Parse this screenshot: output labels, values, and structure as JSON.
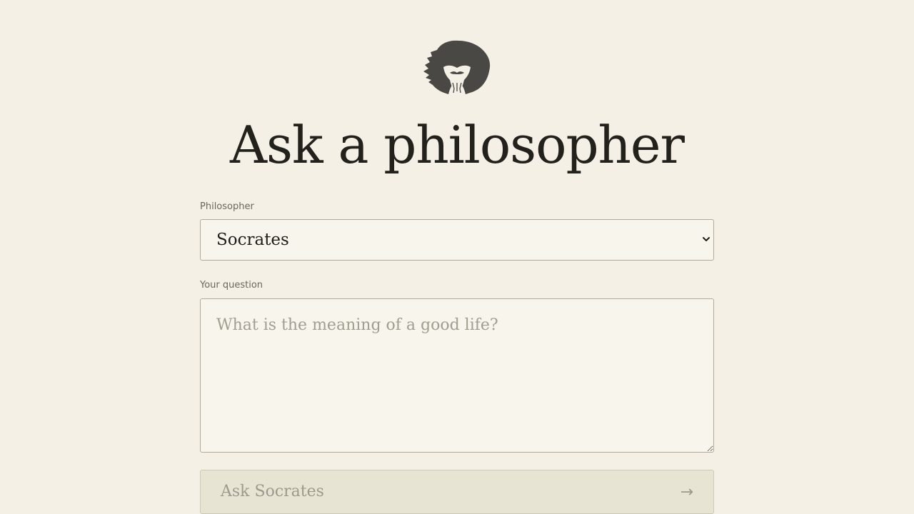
{
  "header": {
    "logo_icon": "philosopher-head-icon",
    "title": "Ask a philosopher"
  },
  "form": {
    "philosopher_label": "Philosopher",
    "philosopher_selected": "Socrates",
    "question_label": "Your question",
    "question_value": "",
    "question_placeholder": "What is the meaning of a good life?",
    "submit_label": "Ask Socrates",
    "submit_icon": "arrow-right-icon",
    "submit_arrow": "→"
  },
  "colors": {
    "background": "#f4f0e6",
    "text": "#23211c",
    "field_border": "#b3aa9c",
    "field_background": "#f8f5ec",
    "button_background": "#e8e4d4",
    "muted": "#9e998d"
  }
}
